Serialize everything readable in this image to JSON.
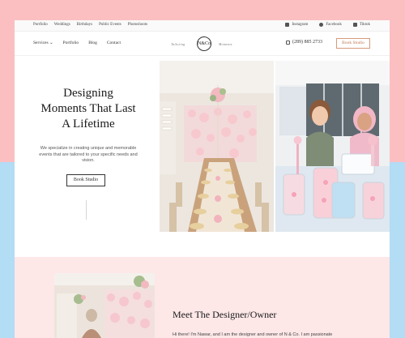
{
  "topbar": {
    "links": [
      "Portfolio",
      "Weddings",
      "Birthdays",
      "Public Events",
      "Photoshoots"
    ],
    "social": [
      {
        "icon": "instagram-icon",
        "label": "Instagram"
      },
      {
        "icon": "facebook-icon",
        "label": "Facebook"
      },
      {
        "icon": "tiktok-icon",
        "label": "Tiktok"
      }
    ]
  },
  "nav": {
    "links": [
      "Services",
      "Portfolio",
      "Blog",
      "Contact"
    ],
    "services_caret": "⌄",
    "logo": {
      "left_word": "Tailoring",
      "monogram": "N&Co",
      "right_word": "Moments"
    },
    "phone": "(289) 885 2733",
    "button": "Book Studio"
  },
  "hero": {
    "title_lines": [
      "Designing",
      "Moments That Last",
      "A Lifetime"
    ],
    "description": "We specialize in creating unique and memorable events that are tailored to your specific needs and vision.",
    "button": "Book Studio"
  },
  "about": {
    "title": "Meet The Designer/Owner",
    "text": "Hi there! I'm Nawar, and I am the designer and owner of N & Co. I am passionate"
  },
  "colors": {
    "bg_pink": "#fbbfc2",
    "bg_blue": "#b3dcf5",
    "section_pink": "#fde7e7",
    "accent": "#d89a7c"
  }
}
